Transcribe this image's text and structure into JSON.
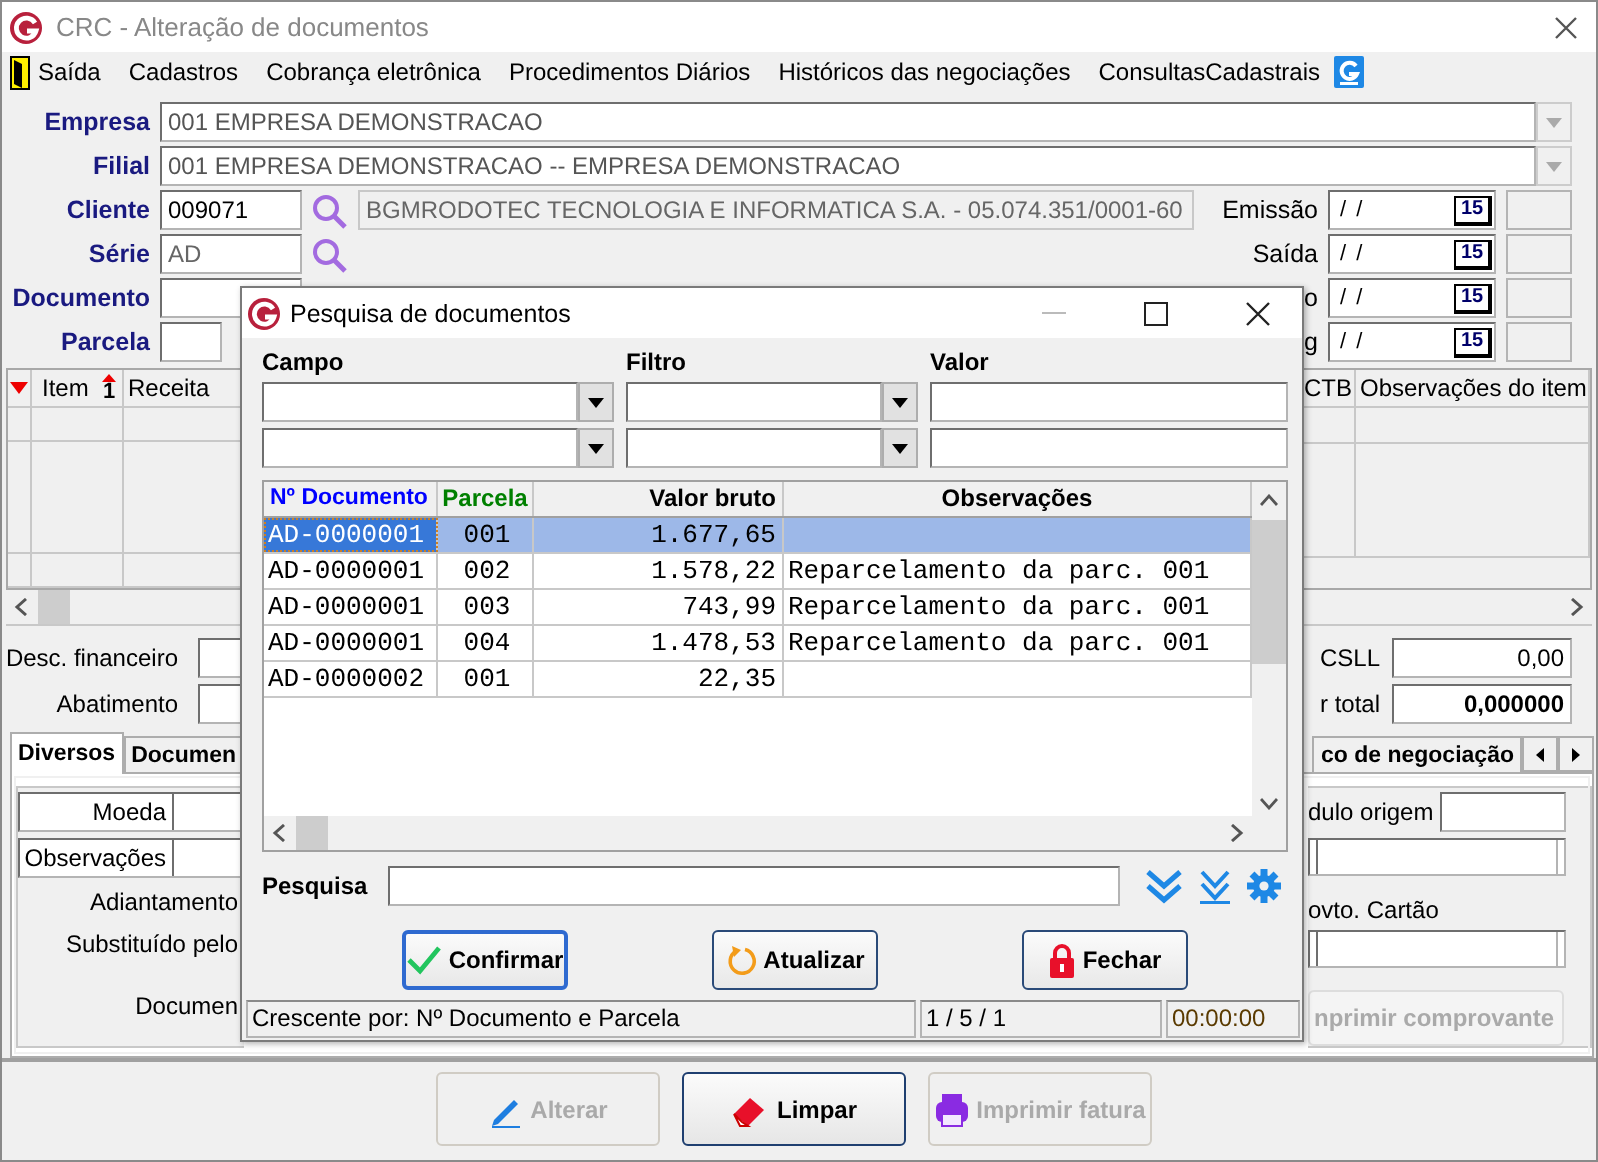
{
  "window": {
    "title": "CRC - Alteração de documentos"
  },
  "menu": [
    {
      "label": "Saída",
      "kind": "exit"
    },
    {
      "label": "Cadastros",
      "kind": "menu"
    },
    {
      "label": "Cobrança eletrônica",
      "kind": "menu"
    },
    {
      "label": "Procedimentos Diários",
      "kind": "menu"
    },
    {
      "label": "Históricos das negociações",
      "kind": "menu"
    },
    {
      "label": "ConsultasCadastrais",
      "kind": "menu"
    }
  ],
  "form": {
    "empresa": {
      "label": "Empresa",
      "value": "001 EMPRESA DEMONSTRACAO"
    },
    "filial": {
      "label": "Filial",
      "value": "001 EMPRESA DEMONSTRACAO -- EMPRESA DEMONSTRACAO"
    },
    "cliente": {
      "label": "Cliente",
      "value": "009071",
      "name": "BGMRODOTEC TECNOLOGIA E INFORMATICA S.A. - 05.074.351/0001-60"
    },
    "serie": {
      "label": "Série",
      "value": "AD"
    },
    "documento": {
      "label": "Documento"
    },
    "parcela": {
      "label": "Parcela"
    }
  },
  "dates": [
    {
      "label": "Emissão",
      "value": "/ /",
      "icon_text": "15"
    },
    {
      "label": "Saída",
      "value": "/ /",
      "icon_text": "15"
    },
    {
      "label": "o",
      "value": "/ /",
      "icon_text": "15"
    },
    {
      "label": "g",
      "value": "/ /",
      "icon_text": "15"
    }
  ],
  "items_grid": {
    "sort_text": "1",
    "columns_left": [
      "Item",
      "Receita"
    ],
    "columns_right": [
      "CTB",
      "Observações do item"
    ]
  },
  "totals_left": [
    {
      "label": "Desc. financeiro"
    },
    {
      "label": "Abatimento"
    }
  ],
  "totals_right": [
    {
      "label": "CSLL",
      "value": "0,00",
      "bold": false
    },
    {
      "label": "r total",
      "value": "0,000000",
      "bold": true
    }
  ],
  "tabs_left": [
    {
      "label": "Diversos",
      "selected": true
    },
    {
      "label": "Documen",
      "selected": false
    }
  ],
  "tabs_right": [
    {
      "label": "co de negociação",
      "selected": false
    }
  ],
  "panel_left": [
    {
      "label": "Moeda",
      "kind": "field"
    },
    {
      "label": "Observações",
      "kind": "field"
    },
    {
      "label": "Adiantamento",
      "kind": "text"
    },
    {
      "label": "Substituído pelo",
      "kind": "text"
    },
    {
      "label": "Documen",
      "kind": "text"
    }
  ],
  "panel_right": [
    {
      "label": "dulo origem",
      "kind": "labeled_field"
    },
    {
      "kind": "field"
    },
    {
      "label": "ovto. Cartão",
      "kind": "text"
    },
    {
      "kind": "field"
    },
    {
      "label": "nprimir comprovante",
      "kind": "button",
      "disabled": true
    }
  ],
  "buttons": [
    {
      "label": "Alterar",
      "kind": "edit",
      "disabled": true
    },
    {
      "label": "Limpar",
      "kind": "clear",
      "disabled": false
    },
    {
      "label": "Imprimir fatura",
      "kind": "print",
      "disabled": true
    }
  ],
  "dialog": {
    "title": "Pesquisa de documentos",
    "filter_labels": [
      "Campo",
      "Filtro",
      "Valor"
    ],
    "filter_rows": [
      {
        "kind": "empty"
      },
      {
        "kind": "empty"
      }
    ],
    "table": {
      "columns": [
        {
          "label": "Nº Documento",
          "color": "#0000ff"
        },
        {
          "label": "Parcela",
          "color": "#008000"
        },
        {
          "label": "Valor bruto",
          "color": "#000000"
        },
        {
          "label": "Observações",
          "color": "#000000"
        }
      ],
      "rows": [
        {
          "cells": [
            "AD-0000001",
            "001",
            "1.677,65"
          ],
          "selected": true
        },
        {
          "cells": [
            "AD-0000001",
            "002",
            "1.578,22",
            "Reparcelamento da parc. 001"
          ],
          "selected": false
        },
        {
          "cells": [
            "AD-0000001",
            "003",
            "743,99",
            "Reparcelamento da parc. 001"
          ],
          "selected": false
        },
        {
          "cells": [
            "AD-0000001",
            "004",
            "1.478,53",
            "Reparcelamento da parc. 001"
          ],
          "selected": false
        },
        {
          "cells": [
            "AD-0000002",
            "001",
            "22,35"
          ],
          "selected": false
        }
      ]
    },
    "search": {
      "label": "Pesquisa"
    },
    "buttons": [
      {
        "label": "Confirmar",
        "kind": "confirm",
        "default": true
      },
      {
        "label": "Atualizar",
        "kind": "refresh",
        "default": false
      },
      {
        "label": "Fechar",
        "kind": "close",
        "default": false
      }
    ],
    "status": [
      "Crescente por: Nº Documento e Parcela",
      "1 / 5 / 1",
      "00:00:00"
    ]
  }
}
